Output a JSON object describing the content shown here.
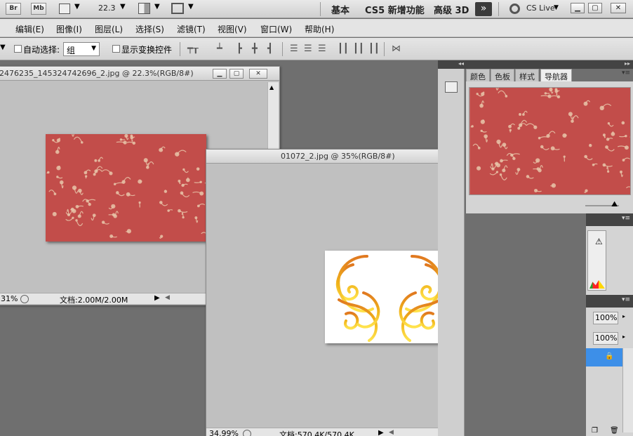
{
  "appbar": {
    "br_label": "Br",
    "mb_label": "Mb",
    "zoom_value": "22.3",
    "workspaces": [
      "基本",
      "CS5 新增功能",
      "高级 3D"
    ],
    "cs_live_label": "CS Live"
  },
  "menu": {
    "items": [
      "编辑(E)",
      "图像(I)",
      "图层(L)",
      "选择(S)",
      "滤镜(T)",
      "视图(V)",
      "窗口(W)",
      "帮助(H)"
    ]
  },
  "options": {
    "auto_select_label": "自动选择:",
    "auto_select_value": "组",
    "show_transform_label": "显示变换控件"
  },
  "doc1": {
    "title": "2476235_145324742696_2.jpg @ 22.3%(RGB/8#)",
    "zoom": "31%",
    "status": "文档:2.00M/2.00M",
    "pattern_bg": "#c24d4a",
    "pattern_fg": "#e8c4a8"
  },
  "doc2": {
    "title": "01072_2.jpg @ 35%(RGB/8#)",
    "zoom": "34.99%",
    "status": "文档:570.4K/570.4K",
    "ornament_color": "#f0b21a"
  },
  "panels": {
    "tabs": [
      "颜色",
      "色板",
      "样式",
      "导航器"
    ],
    "opacity_value": "100%",
    "fill_value": "100%"
  },
  "colors": {
    "layer_highlight": "#3d8fe8"
  }
}
